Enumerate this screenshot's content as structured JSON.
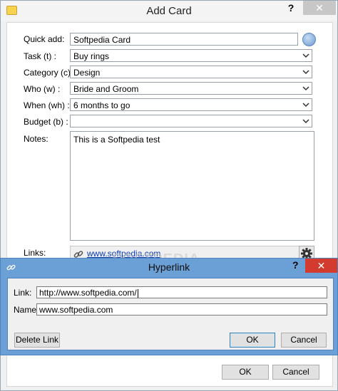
{
  "window": {
    "title": "Add Card",
    "help_label": "?",
    "close_label": "✕"
  },
  "form": {
    "quick_add": {
      "label": "Quick add:",
      "value": "Softpedia Card"
    },
    "task": {
      "label": "Task (t) :",
      "value": "Buy rings"
    },
    "category": {
      "label": "Category (c) :",
      "value": "Design"
    },
    "who": {
      "label": "Who (w) :",
      "value": "Bride and Groom"
    },
    "when": {
      "label": "When (wh) :",
      "value": "6 months to go"
    },
    "budget": {
      "label": "Budget (b) :",
      "value": ""
    },
    "notes": {
      "label": "Notes:",
      "value": "This is a Softpedia test"
    },
    "links": {
      "label": "Links:",
      "value": "www.softpedia.com"
    }
  },
  "footer": {
    "ok_label": "OK",
    "cancel_label": "Cancel"
  },
  "watermark": "SOFTPEDIA",
  "hyperlink_dialog": {
    "title": "Hyperlink",
    "help_label": "?",
    "close_label": "✕",
    "link": {
      "label": "Link:",
      "value": "http://www.softpedia.com/"
    },
    "name": {
      "label": "Name:",
      "value": "www.softpedia.com"
    },
    "delete_label": "Delete Link",
    "ok_label": "OK",
    "cancel_label": "Cancel"
  },
  "colors": {
    "dialog_frame": "#6ba0d6",
    "close_red": "#d23b2e",
    "link_blue": "#0a3bb3"
  }
}
